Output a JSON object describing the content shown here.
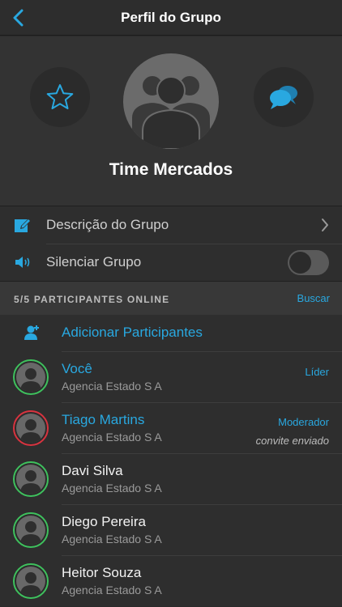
{
  "nav": {
    "title": "Perfil do Grupo",
    "back_icon": "chevron-left-icon"
  },
  "group": {
    "name": "Time Mercados"
  },
  "settings": {
    "description_label": "Descrição do Grupo",
    "mute_label": "Silenciar Grupo",
    "mute_on": false
  },
  "participants": {
    "section_title": "5/5 PARTICIPANTES ONLINE",
    "search_label": "Buscar",
    "add_label": "Adicionar Participantes",
    "members": [
      {
        "name": "Você",
        "org": "Agencia Estado S A",
        "role": "Líder",
        "status": ""
      },
      {
        "name": "Tiago Martins",
        "org": "Agencia Estado S A",
        "role": "Moderador",
        "status": "convite enviado"
      },
      {
        "name": "Davi Silva",
        "org": "Agencia Estado S A",
        "role": "",
        "status": ""
      },
      {
        "name": "Diego Pereira",
        "org": "Agencia Estado S A",
        "role": "",
        "status": ""
      },
      {
        "name": "Heitor Souza",
        "org": "Agencia Estado S A",
        "role": "",
        "status": ""
      }
    ]
  },
  "colors": {
    "accent": "#29a8e0",
    "online": "#3ec15d",
    "pending": "#d8333f",
    "background": "#2a2a2a"
  }
}
